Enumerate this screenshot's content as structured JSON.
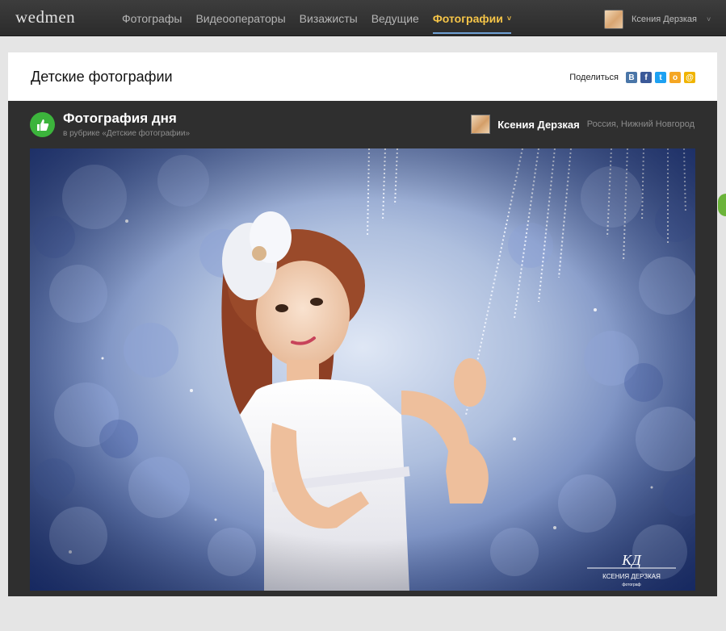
{
  "brand": {
    "logo": "wedmen"
  },
  "nav": {
    "items": [
      {
        "label": "Фотографы"
      },
      {
        "label": "Видеооператоры"
      },
      {
        "label": "Визажисты"
      },
      {
        "label": "Ведущие"
      },
      {
        "label": "Фотографии",
        "active": true,
        "caret": "˅"
      }
    ]
  },
  "user": {
    "name": "Ксения Дерзкая",
    "caret": "˅"
  },
  "page": {
    "title": "Детские фотографии"
  },
  "share": {
    "label": "Поделиться",
    "networks": [
      {
        "name": "vkontakte",
        "glyph": "B",
        "color": "#4a76a8"
      },
      {
        "name": "facebook",
        "glyph": "f",
        "color": "#3b5998"
      },
      {
        "name": "twitter",
        "glyph": "t",
        "color": "#1da1f2"
      },
      {
        "name": "odnoklassniki",
        "glyph": "o",
        "color": "#f5a623"
      },
      {
        "name": "mail",
        "glyph": "@",
        "color": "#f0b400"
      }
    ]
  },
  "photo_of_day": {
    "title": "Фотография дня",
    "subtitle": "в рубрике «Детские фотографии»",
    "badge_icon": "thumbs-up-icon"
  },
  "author": {
    "name": "Ксения Дерзкая",
    "location": "Россия, Нижний Новгород"
  },
  "photo": {
    "watermark_name": "КСЕНИЯ ДЕРЗКАЯ",
    "watermark_sub": "фотограф"
  }
}
